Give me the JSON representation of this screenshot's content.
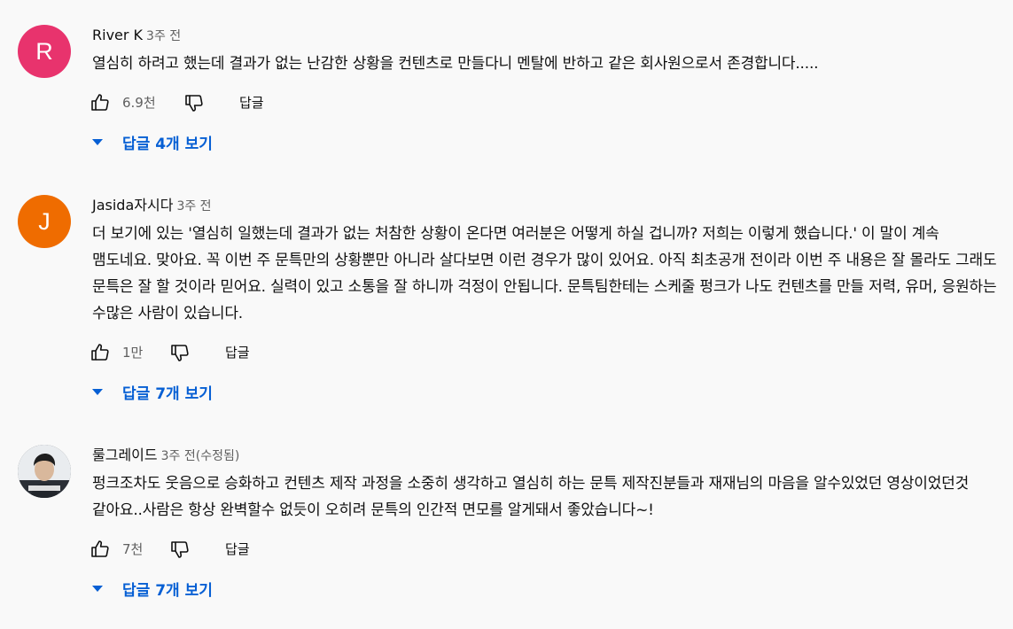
{
  "comments": [
    {
      "author": "River K",
      "time": "3주 전",
      "avatar_letter": "R",
      "avatar_color": "#e8336d",
      "text": "열심히 하려고 했는데 결과가 없는 난감한 상황을 컨텐츠로 만들다니 멘탈에 반하고 같은 회사원으로서 존경합니다.....",
      "likes": "6.9천",
      "reply_label": "답글",
      "replies_label": "답글 4개 보기"
    },
    {
      "author": "Jasida자시다",
      "time": "3주 전",
      "avatar_letter": "J",
      "avatar_color": "#ef6c00",
      "text": "더 보기에 있는 '열심히 일했는데 결과가 없는 처참한 상황이 온다면 여러분은 어떻게 하실 겁니까? 저희는 이렇게 했습니다.' 이 말이 계속 맴도네요. 맞아요. 꼭 이번 주 문특만의 상황뿐만 아니라 살다보면 이런 경우가 많이 있어요. 아직 최초공개 전이라 이번 주 내용은 잘 몰라도 그래도 문특은 잘 할 것이라 믿어요. 실력이 있고 소통을 잘 하니까 걱정이 안됩니다. 문특팀한테는 스케줄 펑크가 나도 컨텐츠를 만들 저력, 유머, 응원하는 수많은 사람이 있습니다.",
      "likes": "1만",
      "reply_label": "답글",
      "replies_label": "답글 7개 보기"
    },
    {
      "author": "룰그레이드",
      "time": "3주 전(수정됨)",
      "avatar_color": "#3a3f45",
      "text": "펑크조차도 웃음으로 승화하고 컨텐츠 제작 과정을 소중히 생각하고 열심히 하는 문특 제작진분들과 재재님의 마음을 알수있었던 영상이었던것 같아요..사람은 항상 완벽할수 없듯이 오히려 문특의 인간적 면모를 알게돼서 좋았습니다~!",
      "likes": "7천",
      "reply_label": "답글",
      "replies_label": "답글 7개 보기"
    }
  ]
}
